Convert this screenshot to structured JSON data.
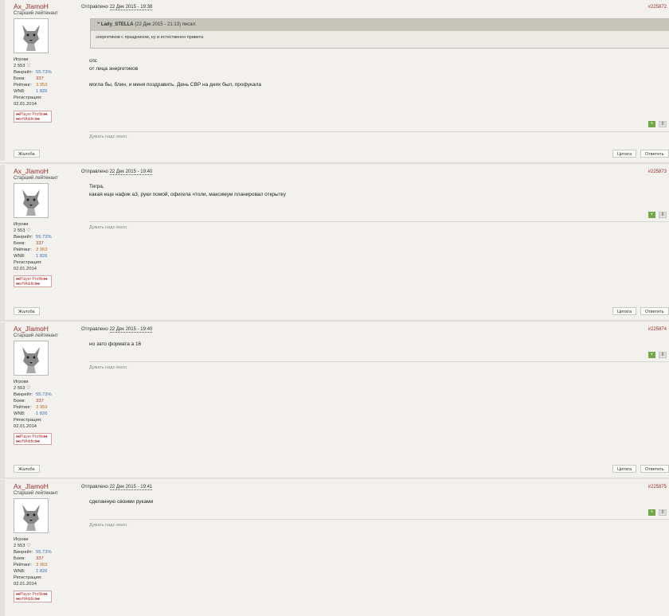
{
  "posts": [
    {
      "author": "Ax_JIamoH",
      "rank": "Старший лейтенант",
      "group_label": "Игроки",
      "posts_count": "2 553",
      "winrate_label": "Винрейт:",
      "winrate": "55.73%",
      "battles_label": "Боев:",
      "battles": "337",
      "rating_label": "Рейтинг:",
      "rating": "3 953",
      "wn8_label": "WN8:",
      "wn8": "1 826",
      "reg_label": "Регистрация:",
      "reg_date": "02.01.2014",
      "badge_line1": "⧓Player Profile⧓",
      "badge_line2": "⧓xHAddict⧓",
      "sent_label": "Отправлено",
      "date": "22 Дек 2015 - 19:38",
      "number": "#225872",
      "quote_head_user": "Lady_STELLA",
      "quote_head_rest": "(22 Дек 2015 - 21:13) писал:",
      "quote_body": "энергетиков с праздником, ну и естественно привета",
      "lines": [
        "спс",
        "от лица энергетиков",
        "",
        "могла бы, блин, и меня поздравить. День СВР на днях был, профукала"
      ],
      "votes": "0",
      "signature": "Думать надо мало.",
      "report": "Жалоба",
      "quote_btn": "Цитата",
      "reply_btn": "Ответить"
    },
    {
      "author": "Ax_JIamoH",
      "rank": "Старший лейтенант",
      "group_label": "Игроки",
      "posts_count": "2 553",
      "winrate_label": "Винрейт:",
      "winrate": "55.73%",
      "battles_label": "Боев:",
      "battles": "337",
      "rating_label": "Рейтинг:",
      "rating": "3 953",
      "wn8_label": "WN8:",
      "wn8": "1 826",
      "reg_label": "Регистрация:",
      "reg_date": "02.01.2014",
      "badge_line1": "⧓Player Profile⧓",
      "badge_line2": "⧓xHAddict⧓",
      "sent_label": "Отправлено",
      "date": "22 Дек 2015 - 19:40",
      "number": "#225873",
      "lines": [
        "Тигра,",
        "какая еще нафик а3, руки помой, офигела чтоли, максимум планировал открытку"
      ],
      "votes": "0",
      "signature": "Думать надо мало.",
      "report": "Жалоба",
      "quote_btn": "Цитата",
      "reply_btn": "Ответить"
    },
    {
      "author": "Ax_JIamoH",
      "rank": "Старший лейтенант",
      "group_label": "Игроки",
      "posts_count": "2 553",
      "winrate_label": "Винрейт:",
      "winrate": "55.73%",
      "battles_label": "Боев:",
      "battles": "337",
      "rating_label": "Рейтинг:",
      "rating": "3 953",
      "wn8_label": "WN8:",
      "wn8": "1 826",
      "reg_label": "Регистрация:",
      "reg_date": "02.01.2014",
      "badge_line1": "⧓Player Profile⧓",
      "badge_line2": "⧓xHAddict⧓",
      "sent_label": "Отправлено",
      "date": "22 Дек 2015 - 19:40",
      "number": "#225874",
      "lines": [
        "но зато формата а 16"
      ],
      "votes": "0",
      "signature": "Думать надо мало.",
      "report": "Жалоба",
      "quote_btn": "Цитата",
      "reply_btn": "Ответить"
    },
    {
      "author": "Ax_JIamoH",
      "rank": "Старший лейтенант",
      "group_label": "Игроки",
      "posts_count": "2 553",
      "winrate_label": "Винрейт:",
      "winrate": "55.73%",
      "battles_label": "Боев:",
      "battles": "337",
      "rating_label": "Рейтинг:",
      "rating": "3 953",
      "wn8_label": "WN8:",
      "wn8": "1 826",
      "reg_label": "Регистрация:",
      "reg_date": "02.01.2014",
      "badge_line1": "⧓Player Profile⧓",
      "badge_line2": "⧓xHAddict⧓",
      "sent_label": "Отправлено",
      "date": "22 Дек 2015 - 19:41",
      "number": "#225875",
      "lines": [
        "сделанную своими руками"
      ],
      "votes": "0",
      "signature": "Думать надо мало."
    }
  ],
  "icons": {
    "vote_up": "plus-icon",
    "quote": "quote-icon",
    "reputation": "heart-icon"
  },
  "colors": {
    "author": "#9b2c2c",
    "vote_up": "#72a845",
    "winrate": "#3c6fb3",
    "rating": "#c66a18"
  }
}
